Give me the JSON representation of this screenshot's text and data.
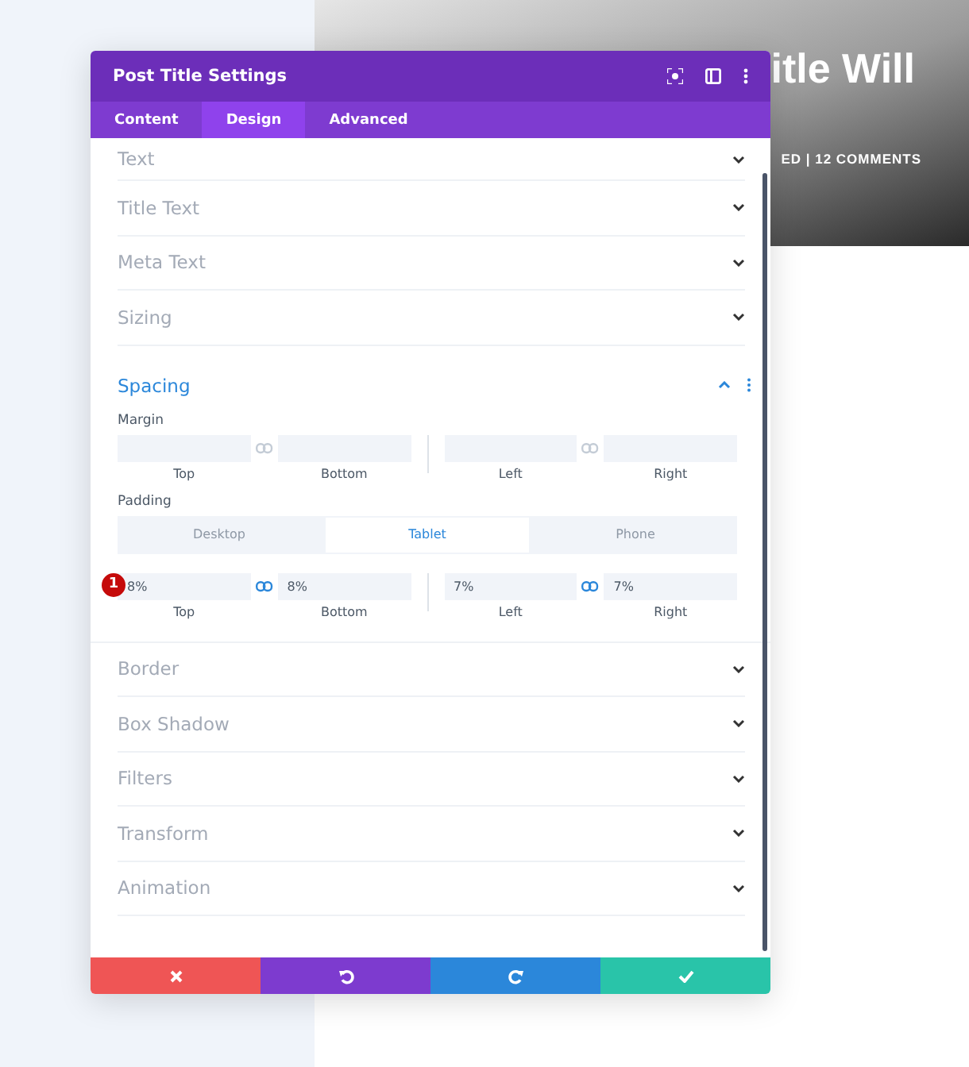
{
  "hero": {
    "title": "itle Will",
    "meta": "ED | 12 COMMENTS"
  },
  "panel": {
    "title": "Post Title Settings",
    "tabs": [
      {
        "label": "Content",
        "selected": false
      },
      {
        "label": "Design",
        "selected": true
      },
      {
        "label": "Advanced",
        "selected": false
      }
    ],
    "sections_before": [
      {
        "title": "Text",
        "expanded": false
      },
      {
        "title": "Title Text",
        "expanded": false
      },
      {
        "title": "Meta Text",
        "expanded": false
      },
      {
        "title": "Sizing",
        "expanded": false
      }
    ],
    "spacing": {
      "title": "Spacing",
      "expanded": true,
      "margin": {
        "label": "Margin",
        "linked": [
          false,
          false
        ],
        "fields": [
          {
            "label": "Top"
          },
          {
            "label": "Bottom"
          },
          {
            "label": "Left"
          },
          {
            "label": "Right"
          }
        ]
      },
      "padding": {
        "label": "Padding",
        "badge": "1",
        "devices": [
          {
            "label": "Desktop",
            "selected": false
          },
          {
            "label": "Tablet",
            "selected": true
          },
          {
            "label": "Phone",
            "selected": false
          }
        ],
        "linked": [
          true,
          true
        ],
        "fields": [
          {
            "label": "Top",
            "value": "8%"
          },
          {
            "label": "Bottom",
            "value": "8%"
          },
          {
            "label": "Left",
            "value": "7%"
          },
          {
            "label": "Right",
            "value": "7%"
          }
        ]
      }
    },
    "sections_after": [
      {
        "title": "Border",
        "expanded": false
      },
      {
        "title": "Box Shadow",
        "expanded": false
      },
      {
        "title": "Filters",
        "expanded": false
      },
      {
        "title": "Transform",
        "expanded": false
      },
      {
        "title": "Animation",
        "expanded": false
      }
    ],
    "footer": [
      {
        "kind": "cancel"
      },
      {
        "kind": "undo"
      },
      {
        "kind": "redo"
      },
      {
        "kind": "save"
      }
    ]
  }
}
